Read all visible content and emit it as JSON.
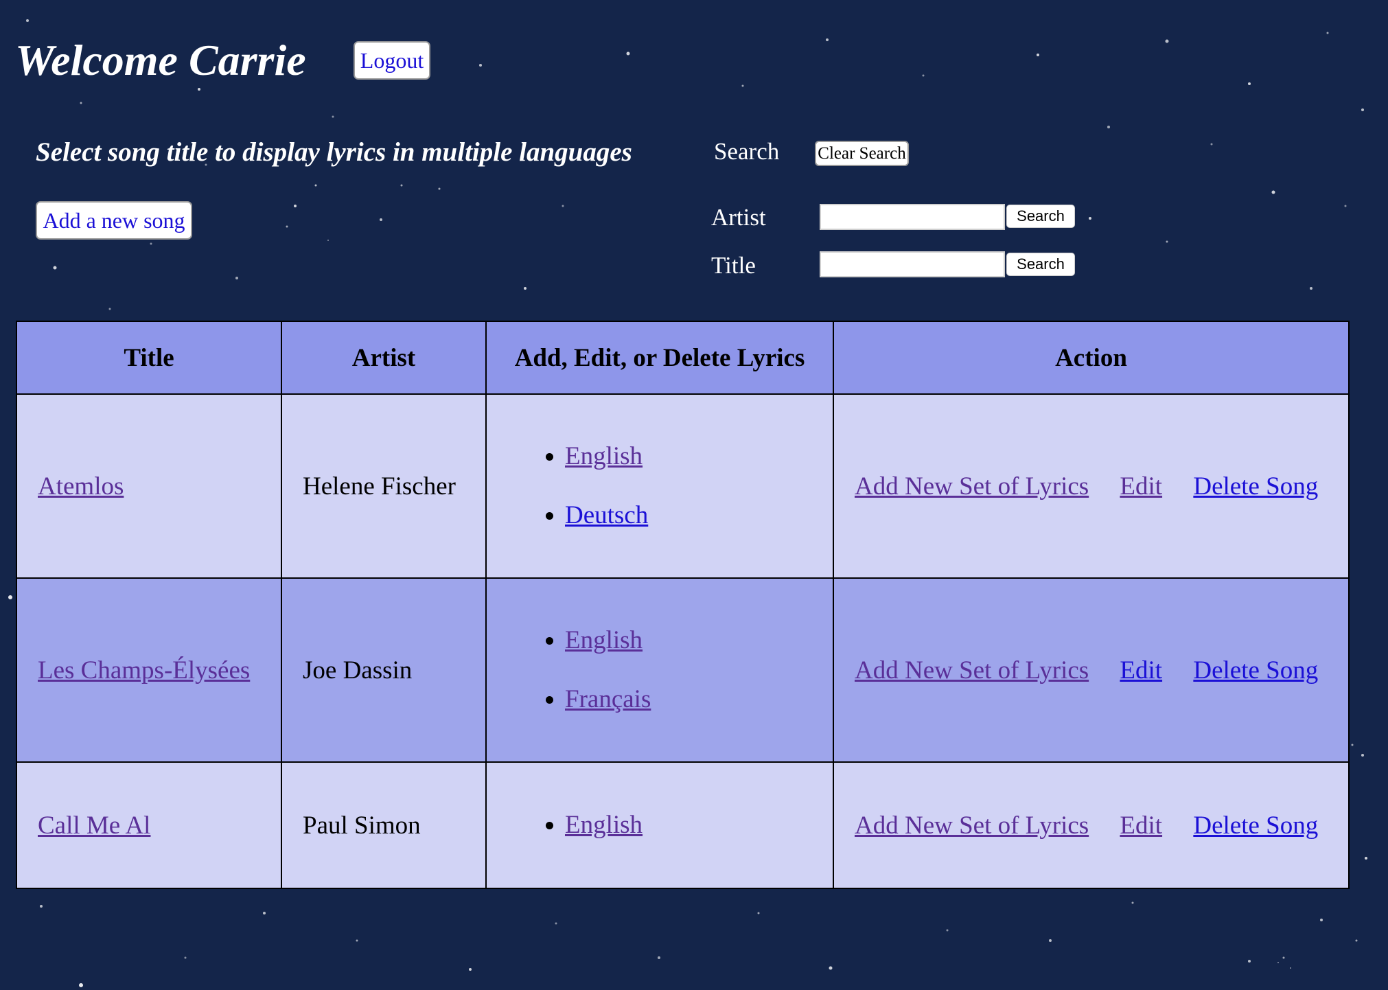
{
  "header": {
    "welcome": "Welcome Carrie",
    "logout_label": "Logout"
  },
  "intro": {
    "subtitle": "Select song title to display lyrics in multiple languages",
    "add_song_label": "Add a new song"
  },
  "search": {
    "heading": "Search",
    "clear_label": "Clear Search",
    "artist_label": "Artist",
    "title_label": "Title",
    "artist_value": "",
    "title_value": "",
    "artist_button": "Search",
    "title_button": "Search"
  },
  "table": {
    "headers": [
      "Title",
      "Artist",
      "Add, Edit, or Delete Lyrics",
      "Action"
    ],
    "rows": [
      {
        "title": "Atemlos",
        "artist": "Helene Fischer",
        "languages": [
          "English",
          "Deutsch"
        ],
        "actions": [
          "Add New Set of Lyrics",
          "Edit",
          "Delete Song"
        ]
      },
      {
        "title": "Les Champs-Élysées",
        "artist": "Joe Dassin",
        "languages": [
          "English",
          "Français"
        ],
        "actions": [
          "Add New Set of Lyrics",
          "Edit",
          "Delete Song"
        ]
      },
      {
        "title": "Call Me Al",
        "artist": "Paul Simon",
        "languages": [
          "English"
        ],
        "actions": [
          "Add New Set of Lyrics",
          "Edit",
          "Delete Song"
        ]
      }
    ]
  },
  "colors": {
    "background": "#14254a",
    "header_row": "#8e96ea",
    "row_light": "#d1d3f5",
    "row_mid": "#9ea5eb",
    "link_visited": "#5a2f98",
    "link_unvisited": "#1b10d6"
  }
}
